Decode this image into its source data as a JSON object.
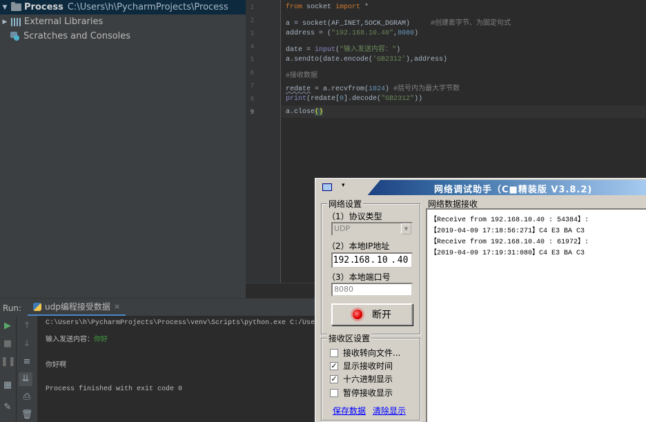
{
  "project_tree": {
    "items": [
      {
        "name": "Process",
        "path": "C:\\Users\\h\\PycharmProjects\\Process"
      },
      {
        "name": "External Libraries"
      },
      {
        "name": "Scratches and Consoles"
      }
    ]
  },
  "editor": {
    "line_numbers": [
      "1",
      "2",
      "3",
      "4",
      "5",
      "6",
      "7",
      "8",
      "9"
    ],
    "lines": {
      "l1": {
        "kw1": "from",
        "mod": " socket ",
        "kw2": "import",
        "rest": " *"
      },
      "l2": {
        "a": "a = socket(AF_INET,SOCK_DGRAM)",
        "cmt": "     #创建套字节、为固定句式"
      },
      "l3": {
        "a": "address = (",
        "str": "\"192.168.10.40\"",
        "b": ",",
        "num": "8080",
        "c": ")"
      },
      "l4": {
        "a": "date = ",
        "fn": "input",
        "b": "(",
        "str": "\"输入发送内容：\"",
        "c": ")"
      },
      "l5": {
        "a": "a.sendto(date.encode(",
        "str": "'GB2312'",
        "b": "),address)"
      },
      "l6": {
        "cmt": "#接收数据"
      },
      "l7": {
        "sq": "redate",
        "a": " = a.recvfrom(",
        "num": "1024",
        "b": ") ",
        "cmt": "#括号内为最大字节数"
      },
      "l8": {
        "fn": "print",
        "a": "(redate[",
        "num": "0",
        "b": "].decode(",
        "str": "\"GB2312\"",
        "c": "))"
      },
      "l9": {
        "a": "a.close",
        "paren": "()"
      }
    }
  },
  "run_panel": {
    "label": "Run:",
    "tab": "udp编程接受数据",
    "close_glyph": "×",
    "console": {
      "cmd": "C:\\Users\\h\\PycharmProjects\\Process\\venv\\Scripts\\python.exe C:/Users",
      "prompt": "输入发送内容：",
      "input": "你好",
      "output": "你好啊",
      "exit": "Process finished with exit code 0"
    },
    "toolbar_icons": [
      "run-icon",
      "stop-icon",
      "pause-icon",
      "layout-icon",
      "pin-icon",
      "up-arrow-icon",
      "down-arrow-icon",
      "soft-wrap-icon",
      "scroll-to-end-icon",
      "print-icon",
      "trash-icon"
    ]
  },
  "net_tool": {
    "title": "网络调试助手（C■精装版 V3.8.2)",
    "sys_menu_glyph": "▾",
    "settings": {
      "group_title": "网络设置",
      "protocol_label": "（1）协议类型",
      "protocol_value": "UDP",
      "ip_label": "（2）本地IP地址",
      "ip": [
        "192",
        "168",
        "10",
        "40"
      ],
      "port_label": "（3）本地端口号",
      "port_value": "8080",
      "disconnect_label": "断开"
    },
    "recv_settings": {
      "group_title": "接收区设置",
      "options": [
        {
          "label": "接收转向文件...",
          "checked": false
        },
        {
          "label": "显示接收时间",
          "checked": true
        },
        {
          "label": "十六进制显示",
          "checked": true
        },
        {
          "label": "暂停接收显示",
          "checked": false
        }
      ],
      "save_link": "保存数据",
      "clear_link": "清除显示"
    },
    "recv_area": {
      "title": "网络数据接收",
      "lines": [
        "【Receive from 192.168.10.40 : 54384】:",
        "【2019-04-09 17:18:56:271】C4 E3 BA C3",
        "【Receive from 192.168.10.40 : 61972】:",
        "【2019-04-09 17:19:31:080】C4 E3 BA C3"
      ]
    }
  }
}
